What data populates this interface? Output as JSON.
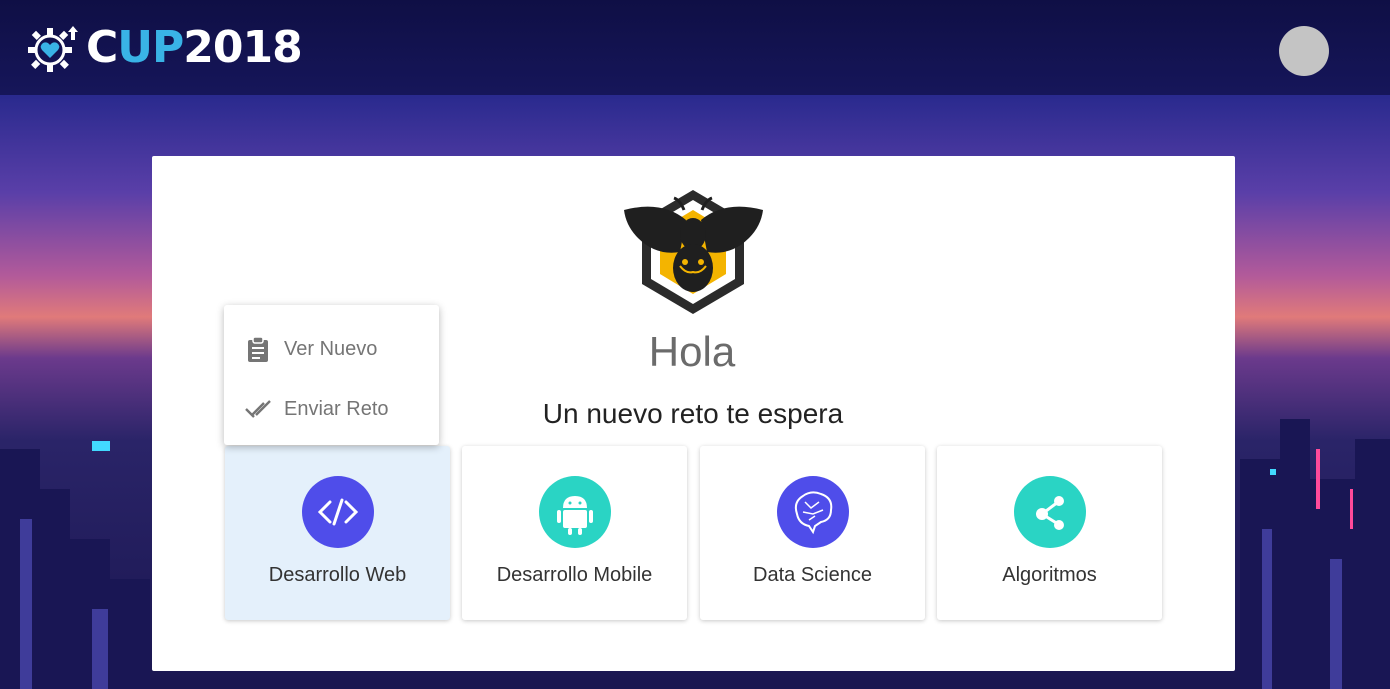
{
  "header": {
    "logo": {
      "part1": "C",
      "part2": "UP",
      "part3": "2018"
    }
  },
  "main": {
    "greeting": "Hola",
    "subtitle": "Un nuevo reto te espera",
    "categories": [
      {
        "label": "Desarrollo Web",
        "icon": "code-icon",
        "color": "#4f4dea",
        "active": true
      },
      {
        "label": "Desarrollo Mobile",
        "icon": "android-icon",
        "color": "#2ad4c4",
        "active": false
      },
      {
        "label": "Data Science",
        "icon": "brain-icon",
        "color": "#4f4dea",
        "active": false
      },
      {
        "label": "Algoritmos",
        "icon": "share-icon",
        "color": "#2ad4c4",
        "active": false
      }
    ]
  },
  "context_menu": {
    "items": [
      {
        "label": "Ver Nuevo",
        "icon": "clipboard-icon"
      },
      {
        "label": "Enviar Reto",
        "icon": "double-check-icon"
      }
    ]
  },
  "colors": {
    "header_bg": "#16165a",
    "accent_blue": "#39b3e6",
    "tile_active_bg": "#e4f0fb",
    "purple": "#4f4dea",
    "teal": "#2ad4c4"
  }
}
